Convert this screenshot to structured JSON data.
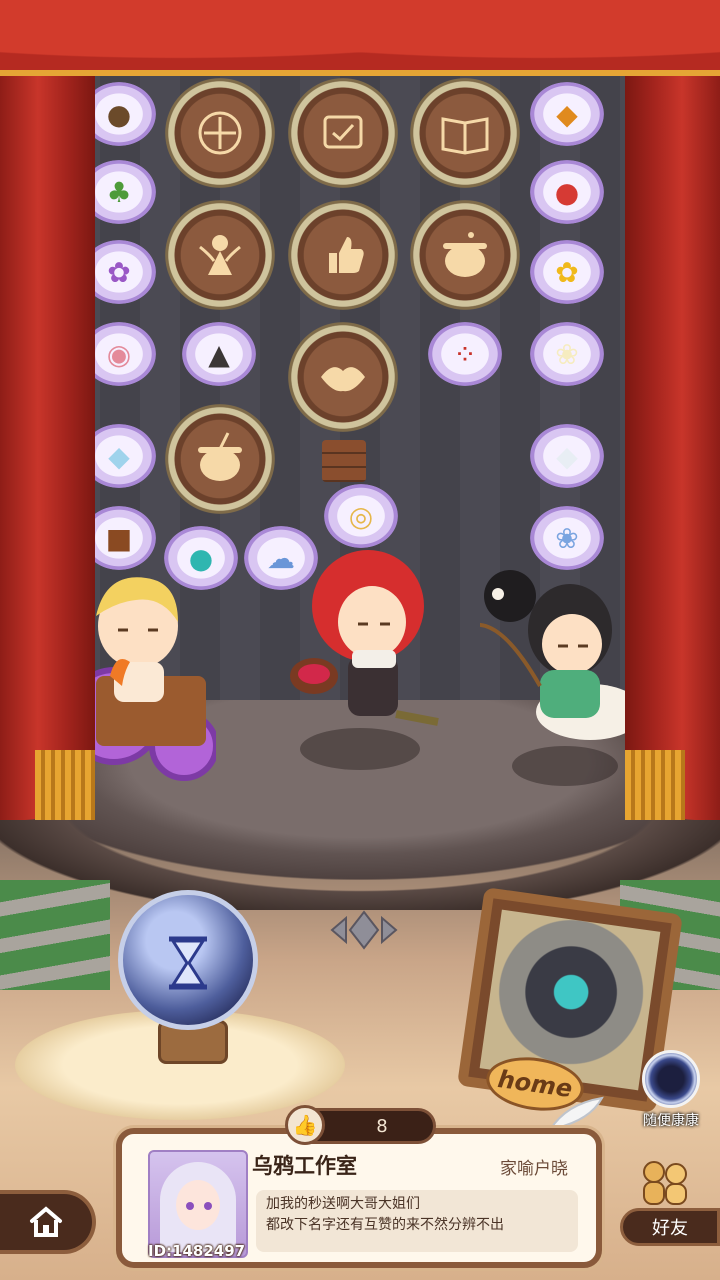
{
  "scene": {
    "slots_row1": [
      "ornament-slot",
      "scroll-certificate-slot",
      "book-slot"
    ],
    "slots_row2": [
      "fairy-slot",
      "thumbs-up-slot",
      "cauldron-slot"
    ],
    "slots_row3": [
      "lips-slot"
    ],
    "slots_row4": [
      "cauldron-slot"
    ],
    "items_left": [
      "dirt-material-icon",
      "herb-leaves-icon",
      "purple-coral-icon",
      "meat-icon",
      "ice-crystal-icon",
      "wood-block-icon"
    ],
    "items_right": [
      "amber-stone-icon",
      "red-fruit-icon",
      "golden-flower-icon",
      "white-lily-icon",
      "white-rock-icon",
      "blue-flower-icon"
    ],
    "items_mid": [
      "dark-shard-icon",
      "red-seeds-icon",
      "teal-potion-icon",
      "blue-mushroom-icon",
      "mirror-icon"
    ]
  },
  "like": {
    "count": "8"
  },
  "profile": {
    "studio_name": "乌鸦工作室",
    "owner_name": "家喻户晓",
    "user_id": "ID:1482497",
    "message_line1": "加我的秒送啊大哥大姐们",
    "message_line2": "都改下名字还有互赞的来不然分辨不出"
  },
  "random_visit": {
    "label": "随便康康"
  },
  "friends": {
    "label": "好友"
  },
  "home_badge": {
    "label": "home"
  },
  "colors": {
    "curtain": "#c8352a",
    "fringe": "#e7a531",
    "panel_border": "#8a5a3b"
  }
}
